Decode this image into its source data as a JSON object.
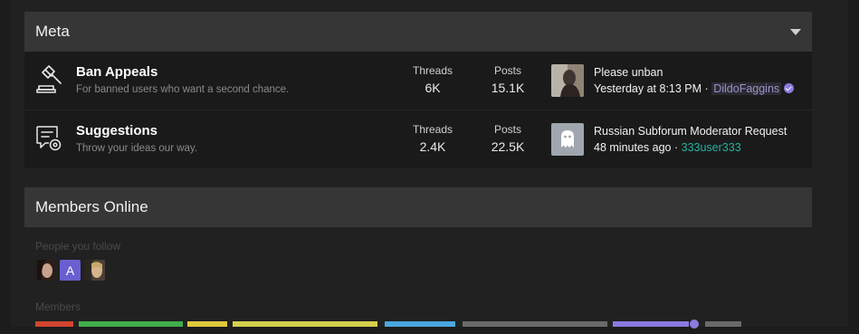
{
  "meta_section": {
    "title": "Meta",
    "forums": [
      {
        "title": "Ban Appeals",
        "description": "For banned users who want a second chance.",
        "threads_label": "Threads",
        "threads": "6K",
        "posts_label": "Posts",
        "posts": "15.1K",
        "last_post_title": "Please unban",
        "last_post_time": "Yesterday at 8:13 PM",
        "separator": "·",
        "last_post_user": "DildoFaggins"
      },
      {
        "title": "Suggestions",
        "description": "Throw your ideas our way.",
        "threads_label": "Threads",
        "threads": "2.4K",
        "posts_label": "Posts",
        "posts": "22.5K",
        "last_post_title": "Russian Subforum Moderator Request",
        "last_post_time": "48 minutes ago",
        "separator": "·",
        "last_post_user": "333user333"
      }
    ]
  },
  "members_online": {
    "title": "Members Online",
    "following_label": "People you follow",
    "following_avatar_letter": "A",
    "members_label": "Members"
  },
  "colors": {
    "verified_badge": "#8b7bdf",
    "user_teal": "#23b3a0"
  }
}
